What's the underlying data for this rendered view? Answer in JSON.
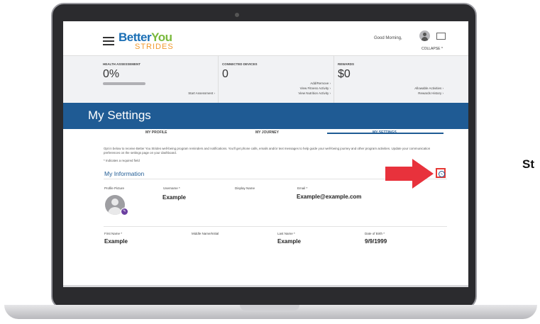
{
  "header": {
    "logo_main": "Better",
    "logo_you": "You",
    "logo_sub": "STRIDES",
    "greeting": "Good Morning,",
    "collapse": "COLLAPSE ^"
  },
  "stats": {
    "health": {
      "title": "HEALTH ASSESSEMENT",
      "value": "0%",
      "progress": 0,
      "link": "Start Assessment ›"
    },
    "devices": {
      "title": "CONNECTED DEVICES",
      "value": "0",
      "links": [
        "Add/Remove ›",
        "View Fitness Activity ›",
        "View Nutrition Activity ›"
      ]
    },
    "rewards": {
      "title": "REWARDS",
      "value": "$0",
      "links": [
        "Allowable Activities ›",
        "Rewards History ›"
      ]
    }
  },
  "page_title": "My Settings",
  "tabs": [
    {
      "label": "MY PROFILE"
    },
    {
      "label": "MY JOURNEY"
    },
    {
      "label": "MY SETTINGS",
      "active": true
    }
  ],
  "intro_text": "Opt in below to receive Better You Strides well-being program reminders and notifications. You'll get phone calls, emails and/or text messages to help guide your well-being journey and other program activities. Update your communication preferences on the settings page on your dashboard.",
  "required_note": "* Indicates a required field",
  "section_title": "My Information",
  "fields": {
    "profile_picture_label": "Profile Picture",
    "username_label": "Username *",
    "username_value": "Example",
    "display_name_label": "Display Name",
    "email_label": "Email *",
    "email_value": "Example@example.com",
    "first_name_label": "First Name *",
    "first_name_value": "Example",
    "middle_name_label": "Middle Name/Initial",
    "last_name_label": "Last Name *",
    "last_name_value": "Example",
    "dob_label": "Date of Birth *",
    "dob_value": "9/9/1999"
  },
  "side_text": "St",
  "colors": {
    "brand_blue": "#1f5b94",
    "arrow_red": "#e8323c",
    "logo_green": "#79b93c",
    "logo_orange": "#f29a2e"
  }
}
